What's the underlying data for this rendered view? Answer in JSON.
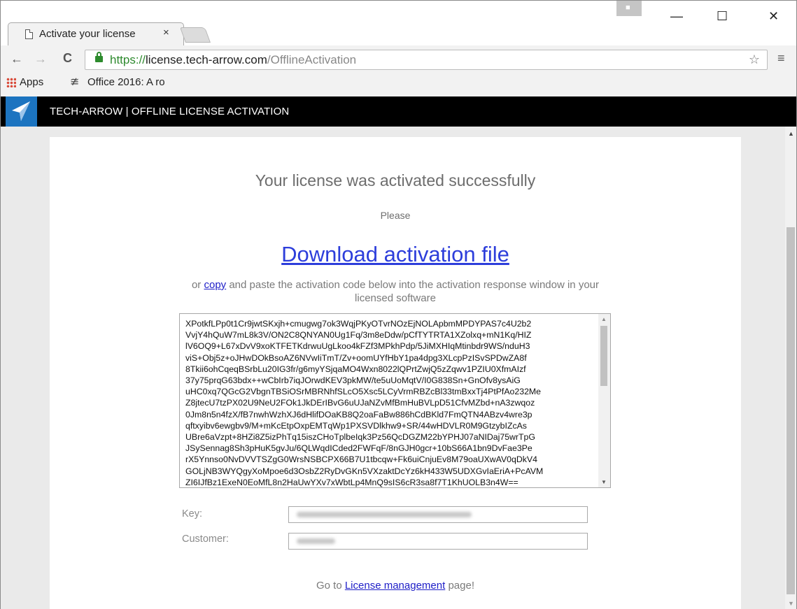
{
  "browser": {
    "tab_title": "Activate your license",
    "tab_close": "×",
    "url_scheme": "https://",
    "url_host": "license.tech-arrow.com",
    "url_path": "/OfflineActivation",
    "bookmarks": [
      {
        "label": "Apps"
      },
      {
        "label": "Office 2016: A ro"
      }
    ],
    "minimize": "—",
    "maximize": "☐",
    "close": "✕"
  },
  "site": {
    "header_title": "TECH-ARROW | OFFLINE LICENSE ACTIVATION"
  },
  "content": {
    "headline": "Your license was activated successfully",
    "please": "Please",
    "download_link": "Download activation file",
    "instructions_prefix": "or ",
    "copy_link": "copy",
    "instructions_suffix": " and paste the activation code below into the activation response window in your licensed software",
    "activation_code": "XPotkfLPp0t1Cr9jwtSKxjh+cmugwg7ok3WqjPKyOTvrNOzEjNOLApbmMPDYPAS7c4U2b2\nVvjY4hQuW7mL8k3V/ON2C8QNYAN0Ug1Fq/3m8eDdw/pCfTYTRTA1XZolxq+mN1Kq/HIZ\nlV6OQ9+L67xDvV9xoKTFETKdrwuUgLkoo4kFZf3MPkhPdp/5JiMXHIqMtinbdr9WS/nduH3\nviS+Obj5z+oJHwDOkBsoAZ6NVwIiTmT/Zv+oomUYfHbY1pa4dpg3XLcpPzISvSPDwZA8f\n8Tkii6ohCqeqBSrbLu20IG3fr/g6myYSjqaMO4Wxn8022lQPrtZwjQ5zZqwv1PZIU0XfmAIzf\n37y75prqG63bdx++wCbIrb7iqJOrwdKEV3pkMW/te5uUoMqtV/I0G838Sn+GnOfv8ysAiG\nuHC0xq7QGcG2VbgnTBSiOSrMBRNhfSLcO5Xsc5LCyVrmRBZcBl33tmBxxTj4PtPfAo232Me\nZ8jtecU7tzPX02U9NeU2FOk1JkDErIBvG6uUJaNZvMfBmHuBVLpD51CfvMZbd+nA3zwqoz\n0Jm8n5n4fzX/fB7nwhWzhXJ6dHlifDOaKB8Q2oaFaBw886hCdBKld7FmQTN4ABzv4wre3p\nqftxyibv6ewgbv9/M+mKcEtpOxpEMTqWp1PXSVDlkhw9+SR/44wHDVLR0M9GtzybIZcAs\nUBre6aVzpt+8HZi8Z5izPhTq15iszCHoTplbeIqk3Pz56QcDGZM22bYPHJ07aNIDaj75wrTpG\nJSySennag8Sh3pHuK5gvJu/6QLWqdICded2FWFqF/8nGJH0gcr+10bS66A1bn9DvFae3Pe\nrX5Ynnso0NvDVVTSZgG0WrsNSBCPX66B7U1tbcqw+Fk6uiCnjuEv8M79oaUXwAV0qDkV4\nGOLjNB3WYQgyXoMpoe6d3OsbZ2RyDvGKn5VXzaktDcYz6kH433W5UDXGvIaEriA+PcAVM\nZI6IJfBz1ExeN0EoMfL8n2HaUwYXv7xWbtLp4MnQ9sIS6cR3sa8f7T1KhUOLB3n4W==",
    "key_label": "Key:",
    "customer_label": "Customer:",
    "footer_prefix": "Go to ",
    "footer_link": "License management",
    "footer_suffix": " page!"
  },
  "colors": {
    "header_bg": "#000000",
    "logo_bg": "#1c74c0",
    "link": "#2d3edb",
    "secure_green": "#2e8a2e"
  }
}
